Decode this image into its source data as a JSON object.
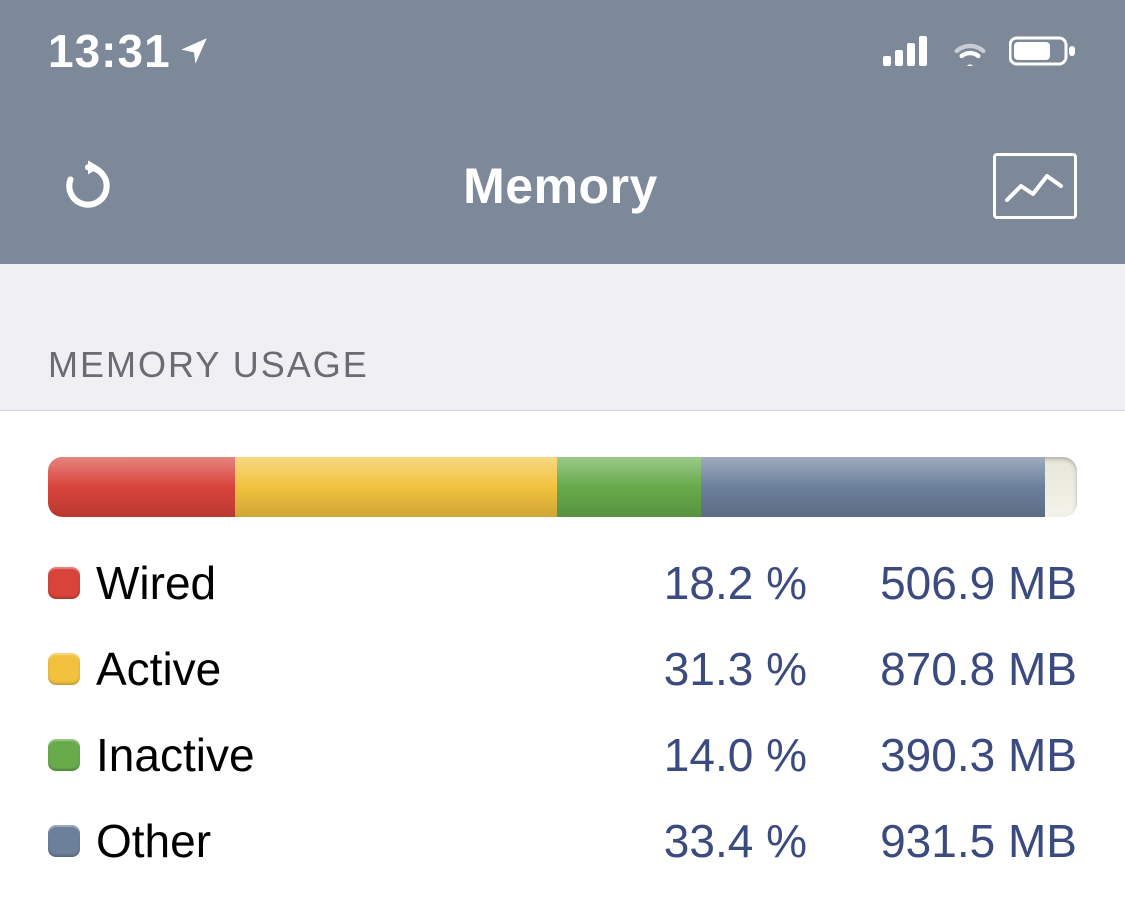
{
  "status_bar": {
    "time": "13:31",
    "location_icon": "location-arrow-icon",
    "signal_icon": "cellular-signal-icon",
    "wifi_icon": "wifi-icon",
    "battery_icon": "battery-icon"
  },
  "nav": {
    "title": "Memory",
    "refresh_icon": "refresh-icon",
    "chart_icon": "chart-line-icon"
  },
  "section": {
    "header": "MEMORY USAGE"
  },
  "colors": {
    "wired": "#d8433a",
    "active": "#f2c23f",
    "inactive": "#67ab4b",
    "other": "#6c7f9b",
    "free": "#e9e9de",
    "navbg": "#7d8899",
    "value": "#3b4b80"
  },
  "chart_data": {
    "type": "bar",
    "title": "Memory Usage",
    "xlabel": "",
    "ylabel": "",
    "unit_left": "%",
    "unit_right": "MB",
    "series": [
      {
        "name": "Wired",
        "percent": 18.2,
        "size_mb": 506.9,
        "color": "#d8433a"
      },
      {
        "name": "Active",
        "percent": 31.3,
        "size_mb": 870.8,
        "color": "#f2c23f"
      },
      {
        "name": "Inactive",
        "percent": 14.0,
        "size_mb": 390.3,
        "color": "#67ab4b"
      },
      {
        "name": "Other",
        "percent": 33.4,
        "size_mb": 931.5,
        "color": "#6c7f9b"
      }
    ],
    "free_percent": 3.1
  },
  "legend": {
    "rows": [
      {
        "label": "Wired",
        "percent": "18.2 %",
        "size": "506.9 MB"
      },
      {
        "label": "Active",
        "percent": "31.3 %",
        "size": "870.8 MB"
      },
      {
        "label": "Inactive",
        "percent": "14.0 %",
        "size": "390.3 MB"
      },
      {
        "label": "Other",
        "percent": "33.4 %",
        "size": "931.5 MB"
      }
    ]
  }
}
